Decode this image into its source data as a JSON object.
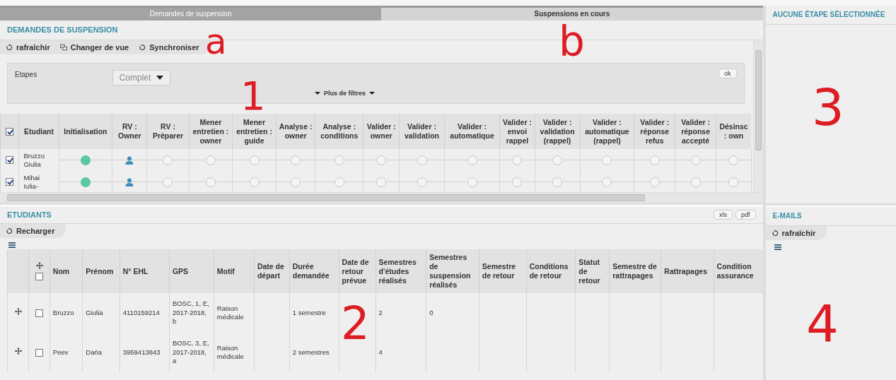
{
  "tabs": [
    {
      "label": "Demandes de suspension",
      "selected": true
    },
    {
      "label": "Suspensions en cours",
      "selected": false
    }
  ],
  "requests": {
    "title": "DEMANDES DE SUSPENSION",
    "toolbar": [
      {
        "label": "rafraîchir",
        "kind": "refresh"
      },
      {
        "label": "Changer de vue",
        "kind": "view"
      },
      {
        "label": "Synchroniser",
        "kind": "refresh"
      }
    ],
    "filters": {
      "label": "Etapes",
      "select": "Complet",
      "ok": "ok",
      "more": "Plus de filtres"
    },
    "all_checked": true,
    "columns": [
      "Etudiant",
      "Initialisation",
      "RV : Owner",
      "RV : Préparer",
      "Mener entretien : owner",
      "Mener entretien : guide",
      "Analyse : owner",
      "Analyse : conditions",
      "Valider : owner",
      "Valider : validation",
      "Valider : automatique",
      "Valider : envoi rappel",
      "Valider : validation (rappel)",
      "Valider : automatique (rappel)",
      "Valider : réponse refus",
      "Valider : réponse accepté",
      "Désinsc : own"
    ],
    "rows": [
      {
        "name": "Bruzzo Giulia",
        "checked": true,
        "steps": [
          {
            "kind": "done"
          },
          {
            "kind": "owner"
          },
          {
            "kind": "todo"
          },
          {
            "kind": "todo"
          },
          {
            "kind": "todo"
          },
          {
            "kind": "todo"
          },
          {
            "kind": "todo"
          },
          {
            "kind": "todo"
          },
          {
            "kind": "todo"
          },
          {
            "kind": "todo"
          },
          {
            "kind": "todo"
          },
          {
            "kind": "todo"
          },
          {
            "kind": "todo"
          },
          {
            "kind": "todo"
          },
          {
            "kind": "todo"
          },
          {
            "kind": "todo"
          }
        ]
      },
      {
        "name": "Mihai Iulia-",
        "checked": true,
        "steps": [
          {
            "kind": "done"
          },
          {
            "kind": "owner"
          },
          {
            "kind": "todo"
          },
          {
            "kind": "todo"
          },
          {
            "kind": "todo"
          },
          {
            "kind": "todo"
          },
          {
            "kind": "todo"
          },
          {
            "kind": "todo"
          },
          {
            "kind": "todo"
          },
          {
            "kind": "todo"
          },
          {
            "kind": "todo"
          },
          {
            "kind": "todo"
          },
          {
            "kind": "todo"
          },
          {
            "kind": "todo"
          },
          {
            "kind": "todo"
          },
          {
            "kind": "todo"
          }
        ]
      }
    ]
  },
  "students": {
    "title": "ETUDIANTS",
    "exports": [
      "xls",
      "pdf"
    ],
    "reload": "Recharger",
    "all_checked": false,
    "columns": [
      "Nom",
      "Prénom",
      "N° EHL",
      "GPS",
      "Motif",
      "Date de départ",
      "Durée demandée",
      "Date de retour prévue",
      "Semestres d'études réalisés",
      "Semestres de suspension réalisés",
      "Semestre de retour",
      "Conditions de retour",
      "Statut de retour",
      "Semestre de rattrapages",
      "Rattrapages",
      "Condition assurance"
    ],
    "rows": [
      {
        "checked": false,
        "nom": "Bruzzo",
        "prenom": "Giulia",
        "ehl": "4110159214",
        "gps": "BOSC, 1, E, 2017-2018, b",
        "motif": "Raison médicale",
        "duree": "1 semestre",
        "sem_etudes": "2",
        "sem_suspension": "0"
      },
      {
        "checked": false,
        "nom": "Peev",
        "prenom": "Daria",
        "ehl": "3959413843",
        "gps": "BOSC, 3, E, 2017-2018, a",
        "motif": "Raison médicale",
        "duree": "2 semestres",
        "sem_etudes": "4"
      }
    ]
  },
  "step_panel": {
    "title": "AUCUNE ÉTAPE SÉLECTIONNÉE"
  },
  "emails": {
    "title": "E-MAILS",
    "refresh": "rafraîchir"
  },
  "annotations": [
    "a",
    "b",
    "1",
    "2",
    "3",
    "4"
  ]
}
